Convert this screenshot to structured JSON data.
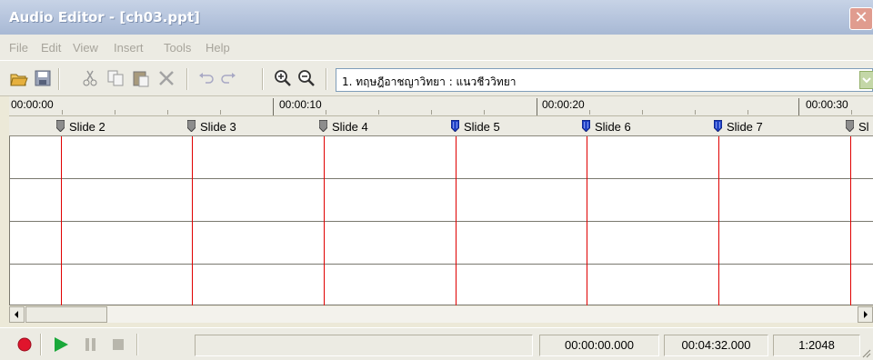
{
  "window": {
    "title": "Audio Editor - [ch03.ppt]",
    "close_glyph": "✕"
  },
  "menu": [
    "File",
    "Edit",
    "View",
    "Insert",
    "Tools",
    "Help"
  ],
  "toolbar": {
    "icons": [
      "open-folder-icon",
      "save-icon",
      "cut-icon",
      "copy-icon",
      "paste-icon",
      "delete-icon",
      "undo-icon",
      "redo-icon",
      "zoom-in-icon",
      "zoom-out-icon"
    ],
    "slide_select": {
      "value": "1. ทฤษฎีอาชญาวิทยา : แนวชีววิทยา"
    }
  },
  "ruler": {
    "labels": [
      "00:00:00",
      "00:00:10",
      "00:00:20",
      "00:00:30"
    ]
  },
  "markers": [
    {
      "label": "Slide 2",
      "type": "grey"
    },
    {
      "label": "Slide 3",
      "type": "grey"
    },
    {
      "label": "Slide 4",
      "type": "grey"
    },
    {
      "label": "Slide 5",
      "type": "blue"
    },
    {
      "label": "Slide 6",
      "type": "blue"
    },
    {
      "label": "Slide 7",
      "type": "blue"
    },
    {
      "label": "Sl",
      "type": "grey"
    }
  ],
  "colors": {
    "marker_line": "#e00000",
    "marker_grey": "#8d8d8d",
    "marker_blue": "#1d3fc4",
    "record": "#e0142c",
    "play": "#1aa83a"
  },
  "status": {
    "message": "",
    "position": "00:00:00.000",
    "duration": "00:04:32.000",
    "zoom": "1:2048"
  }
}
